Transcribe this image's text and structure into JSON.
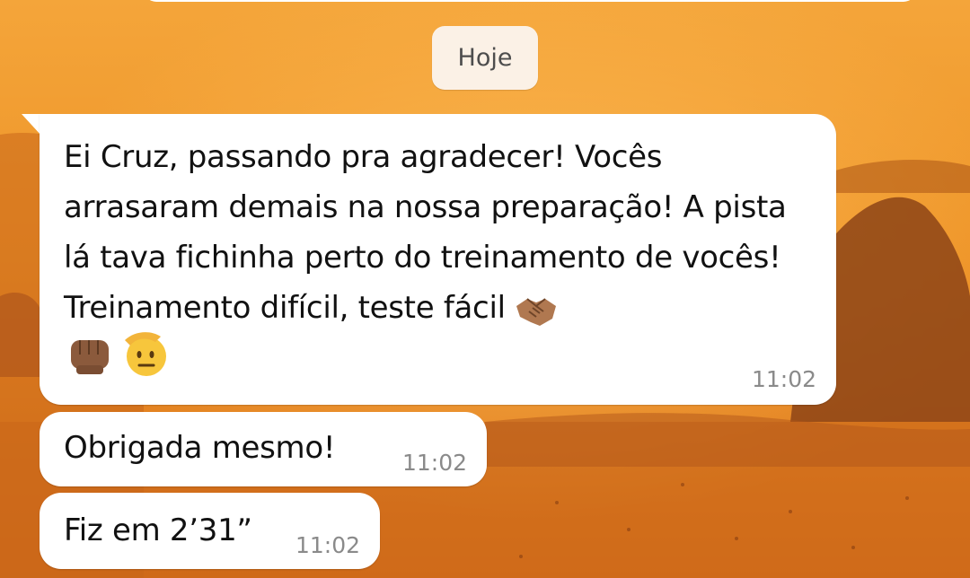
{
  "date_chip": "Hoje",
  "messages": [
    {
      "text": "Ei Cruz, passando pra agradecer! Vocês arrasaram demais na nossa preparação! A pista lá tava fichinha perto do treinamento de vocês! Treinamento difícil, teste fácil",
      "emojis": [
        "handshake-emoji",
        "fist-emoji",
        "saluting-face-emoji"
      ],
      "time": "11:02"
    },
    {
      "text": "Obrigada mesmo!",
      "time": "11:02"
    },
    {
      "text": "Fiz em 2’31”",
      "time": "11:02"
    }
  ],
  "colors": {
    "wallpaper_sky": "#f0a033",
    "wallpaper_sea": "#d9761c",
    "bubble": "#ffffff",
    "date_chip": "#fbf1e6",
    "text": "#111111",
    "timestamp": "#8a8a8a"
  }
}
